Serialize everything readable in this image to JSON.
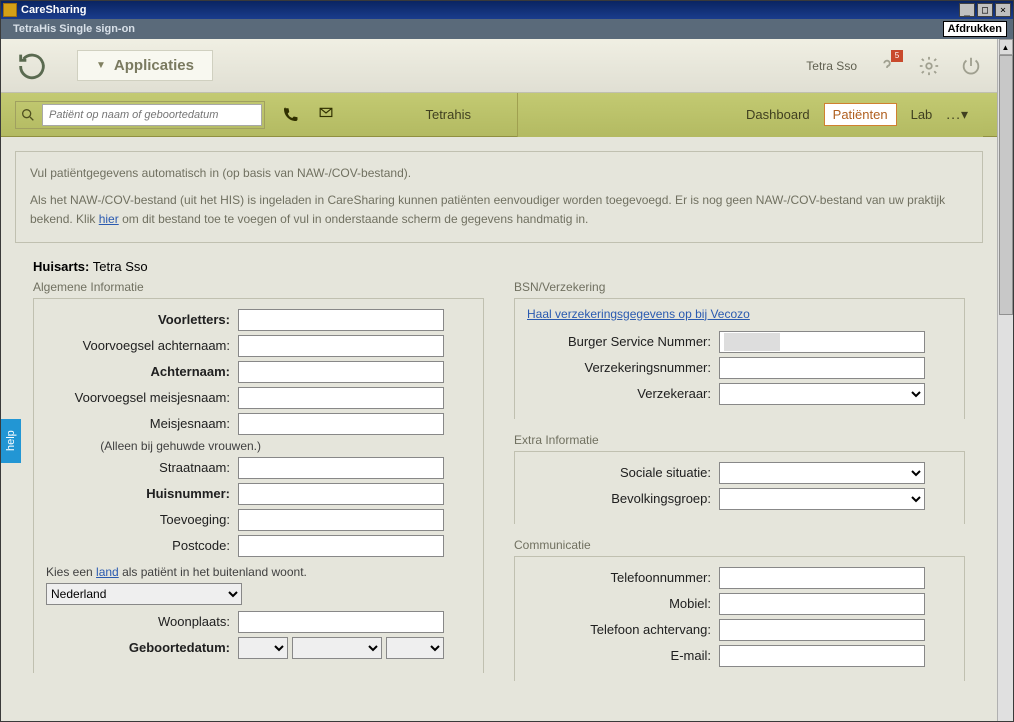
{
  "window": {
    "title": "CareSharing"
  },
  "subtitle": "TetraHis Single sign-on",
  "afdrukken": "Afdrukken",
  "toolbar": {
    "applicaties": "Applicaties",
    "user": "Tetra Sso",
    "notif_count": "5"
  },
  "search": {
    "placeholder": "Patiënt op naam of geboortedatum"
  },
  "navbrand": "Tetrahis",
  "nav": {
    "dashboard": "Dashboard",
    "patienten": "Patiënten",
    "lab": "Lab",
    "more": "..."
  },
  "info": {
    "line1": "Vul patiëntgegevens automatisch in (op basis van NAW-/COV-bestand).",
    "line2a": "Als het NAW-/COV-bestand (uit het HIS) is ingeladen in CareSharing kunnen patiënten eenvoudiger worden toegevoegd. Er is nog geen NAW-/COV-bestand van uw praktijk bekend. Klik ",
    "hier": "hier",
    "line2b": " om dit bestand toe te voegen of vul in onderstaande scherm de gegevens handmatig in."
  },
  "huisarts_label": "Huisarts:",
  "huisarts_value": "Tetra Sso",
  "sections": {
    "algemene": "Algemene Informatie",
    "bsn": "BSN/Verzekering",
    "extra": "Extra Informatie",
    "comm": "Communicatie"
  },
  "labels": {
    "voorletters": "Voorletters:",
    "voorv_achternaam": "Voorvoegsel achternaam:",
    "achternaam": "Achternaam:",
    "voorv_meisjes": "Voorvoegsel meisjesnaam:",
    "meisjesnaam": "Meisjesnaam:",
    "alleen_gehuwde": "(Alleen bij gehuwde vrouwen.)",
    "straatnaam": "Straatnaam:",
    "huisnummer": "Huisnummer:",
    "toevoeging": "Toevoeging:",
    "postcode": "Postcode:",
    "kies_een": "Kies een ",
    "land": "land",
    "buitenland": " als patiënt in het buitenland woont.",
    "nederland": "Nederland",
    "woonplaats": "Woonplaats:",
    "geboortedatum": "Geboortedatum:",
    "haal_vecozo": "Haal verzekeringsgegevens op bij Vecozo",
    "bsn_nr": "Burger Service Nummer:",
    "verz_nr": "Verzekeringsnummer:",
    "verzekeraar": "Verzekeraar:",
    "sociale": "Sociale situatie:",
    "bevolking": "Bevolkingsgroep:",
    "telefoon": "Telefoonnummer:",
    "mobiel": "Mobiel:",
    "tel_achter": "Telefoon achtervang:",
    "email": "E-mail:"
  },
  "help": "help"
}
